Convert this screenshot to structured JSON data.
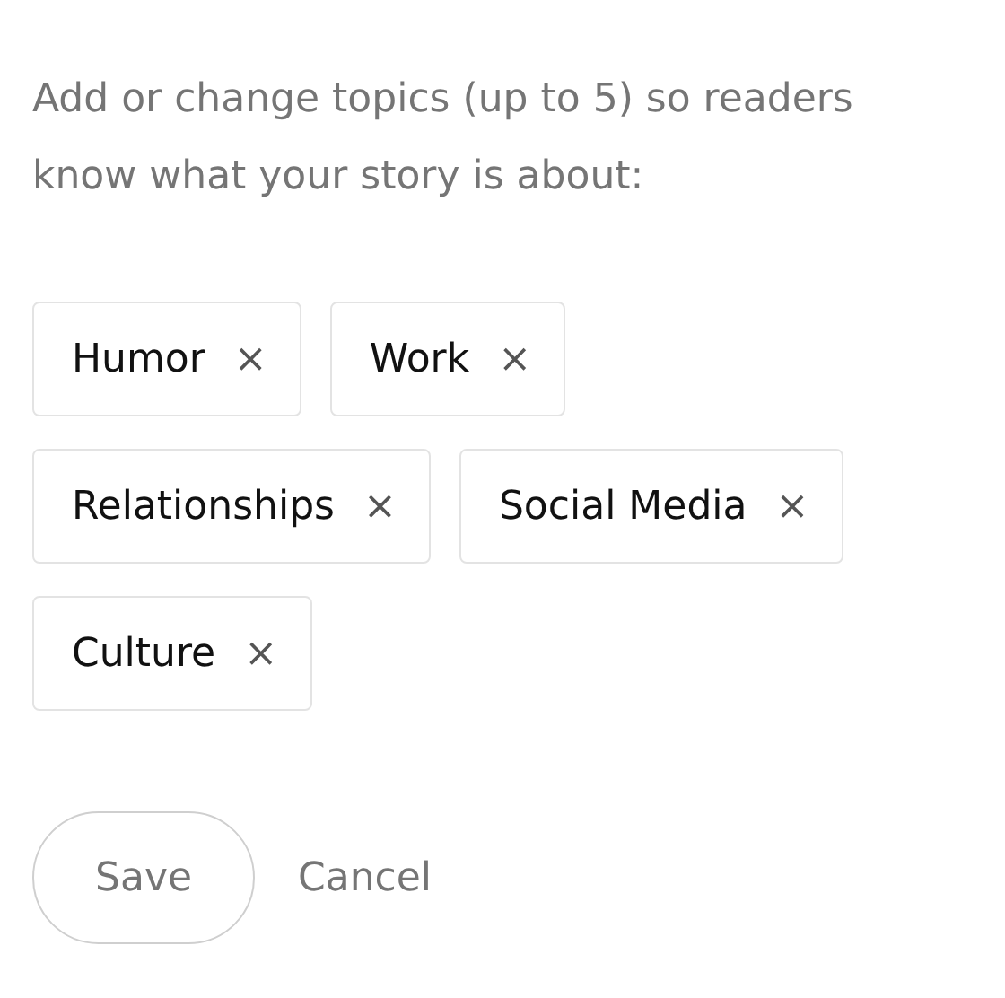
{
  "prompt": "Add or change topics (up to 5) so readers know what your story is about:",
  "topics": [
    {
      "label": "Humor",
      "remove": "×"
    },
    {
      "label": "Work",
      "remove": "×"
    },
    {
      "label": "Relationships",
      "remove": "×"
    },
    {
      "label": "Social Media",
      "remove": "×"
    },
    {
      "label": "Culture",
      "remove": "×"
    }
  ],
  "actions": [
    {
      "kind": "outlined",
      "label": "Save"
    },
    {
      "kind": "plain",
      "label": "Cancel"
    }
  ]
}
